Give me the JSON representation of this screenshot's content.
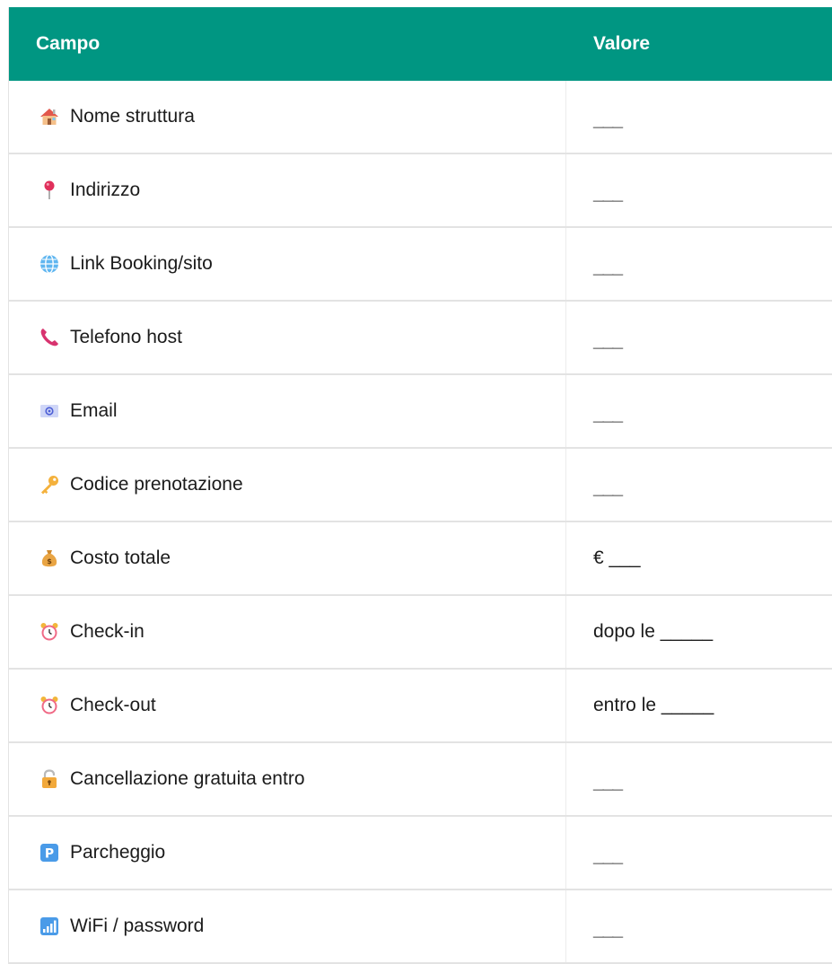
{
  "header": {
    "campo": "Campo",
    "valore": "Valore"
  },
  "colors": {
    "header_bg": "#009682",
    "header_text": "#ffffff",
    "row_border": "#e3e3e3"
  },
  "rows": [
    {
      "icon": "house-icon",
      "label": "Nome struttura",
      "value": "___"
    },
    {
      "icon": "pin-icon",
      "label": "Indirizzo",
      "value": "___"
    },
    {
      "icon": "globe-icon",
      "label": "Link Booking/sito",
      "value": "___"
    },
    {
      "icon": "phone-icon",
      "label": "Telefono host",
      "value": "___"
    },
    {
      "icon": "email-icon",
      "label": "Email",
      "value": "___"
    },
    {
      "icon": "key-icon",
      "label": "Codice prenotazione",
      "value": "___"
    },
    {
      "icon": "money-bag-icon",
      "label": "Costo totale",
      "value": "€ ___"
    },
    {
      "icon": "alarm-clock-icon",
      "label": "Check-in",
      "value": "dopo le _____"
    },
    {
      "icon": "alarm-clock-icon",
      "label": "Check-out",
      "value": "entro le _____"
    },
    {
      "icon": "lock-icon",
      "label": "Cancellazione gratuita entro",
      "value": "___"
    },
    {
      "icon": "parking-icon",
      "label": "Parcheggio",
      "value": "___"
    },
    {
      "icon": "signal-bars-icon",
      "label": "WiFi / password",
      "value": "___"
    }
  ]
}
